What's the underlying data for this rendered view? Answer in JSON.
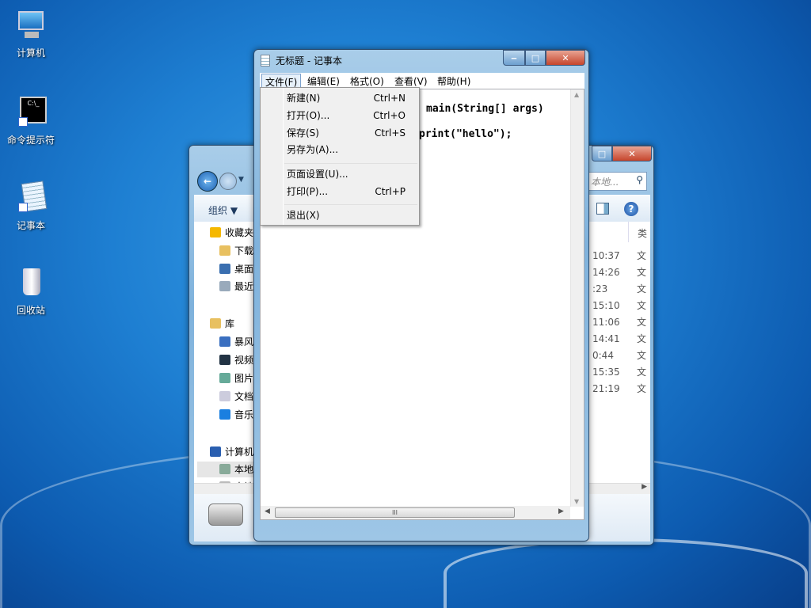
{
  "desktop": {
    "icons": [
      {
        "label": "计算机",
        "icon": "computer-icon"
      },
      {
        "label": "命令提示符",
        "icon": "cmd-icon"
      },
      {
        "label": "记事本",
        "icon": "notepad-icon"
      },
      {
        "label": "回收站",
        "icon": "recycle-bin-icon"
      }
    ]
  },
  "explorer": {
    "search_placeholder": "本地...",
    "toolbar": {
      "organize": "组织 ▼"
    },
    "column_header": "类",
    "nav": [
      {
        "label": "收藏夹",
        "icon": "star-icon"
      },
      {
        "label": "下载",
        "icon": "download-folder-icon"
      },
      {
        "label": "桌面",
        "icon": "desktop-icon"
      },
      {
        "label": "最近",
        "icon": "recent-icon"
      },
      {
        "label": "库",
        "icon": "library-icon"
      },
      {
        "label": "暴风",
        "icon": "video-library-icon"
      },
      {
        "label": "视频",
        "icon": "video-icon"
      },
      {
        "label": "图片",
        "icon": "picture-icon"
      },
      {
        "label": "文档",
        "icon": "document-icon"
      },
      {
        "label": "音乐",
        "icon": "music-icon"
      },
      {
        "label": "计算机",
        "icon": "computer-icon"
      },
      {
        "label": "本地",
        "icon": "local-disk-icon"
      },
      {
        "label": "本地",
        "icon": "disk-icon"
      }
    ],
    "rows": [
      {
        "time": "10:37",
        "type": "文"
      },
      {
        "time": "14:26",
        "type": "文"
      },
      {
        "time": ":23",
        "type": "文"
      },
      {
        "time": "15:10",
        "type": "文"
      },
      {
        "time": "11:06",
        "type": "文"
      },
      {
        "time": "14:41",
        "type": "文"
      },
      {
        "time": "0:44",
        "type": "文"
      },
      {
        "time": "15:35",
        "type": "文"
      },
      {
        "time": "21:19",
        "type": "文"
      }
    ]
  },
  "notepad": {
    "title": "无标题 - 记事本",
    "menubar": [
      "文件(F)",
      "编辑(E)",
      "格式(O)",
      "查看(V)",
      "帮助(H)"
    ],
    "text_lines": [
      "main(String[] args)",
      "print(\"hello\");"
    ],
    "file_menu": [
      {
        "label": "新建(N)",
        "shortcut": "Ctrl+N"
      },
      {
        "label": "打开(O)...",
        "shortcut": "Ctrl+O"
      },
      {
        "label": "保存(S)",
        "shortcut": "Ctrl+S"
      },
      {
        "label": "另存为(A)...",
        "shortcut": ""
      },
      {
        "label": "页面设置(U)...",
        "shortcut": ""
      },
      {
        "label": "打印(P)...",
        "shortcut": "Ctrl+P"
      },
      {
        "label": "退出(X)",
        "shortcut": ""
      }
    ],
    "hscroll_grip": "III"
  }
}
